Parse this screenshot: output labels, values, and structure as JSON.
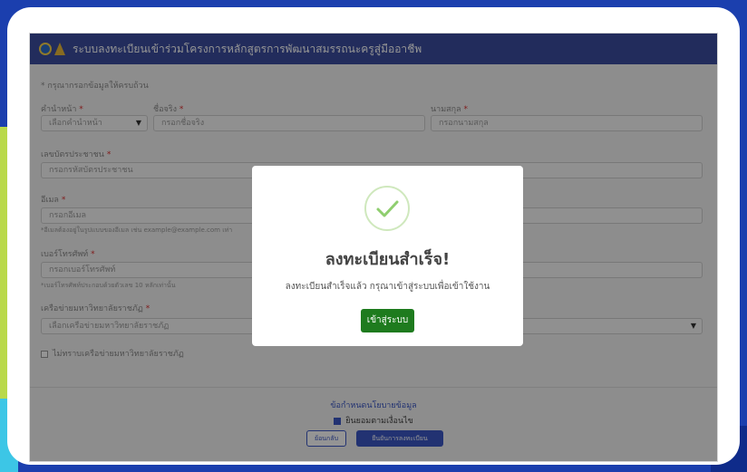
{
  "app": {
    "title": "ระบบลงทะเบียนเข้าร่วมโครงการหลักสูตรการพัฒนาสมรรถนะครูสู่มืออาชีพ"
  },
  "form": {
    "instruction": "* กรุณากรอกข้อมูลให้ครบถ้วน",
    "prefix": {
      "label": "คำนำหน้า",
      "value": "เลือกคำนำหน้า"
    },
    "firstname": {
      "label": "ชื่อจริง",
      "placeholder": "กรอกชื่อจริง"
    },
    "lastname": {
      "label": "นามสกุล",
      "placeholder": "กรอกนามสกุล"
    },
    "id_card": {
      "label": "เลขบัตรประชาชน",
      "placeholder": "กรอกรหัสบัตรประชาชน"
    },
    "email": {
      "label": "อีเมล",
      "placeholder": "กรอกอีเมล",
      "hint": "*อีเมลต้องอยู่ในรูปแบบของอีเมล เช่น example@example.com เท่า"
    },
    "phone": {
      "label": "เบอร์โทรศัพท์",
      "placeholder": "กรอกเบอร์โทรศัพท์",
      "hint": "*เบอร์โทรศัพท์ประกอบด้วยตัวเลข 10 หลักเท่านั้น"
    },
    "network": {
      "label": "เครือข่ายมหาวิทยาลัยราชภัฏ",
      "value": "เลือกเครือข่ายมหาวิทยาลัยราชภัฏ"
    },
    "unknown_network": {
      "label": "ไม่ทราบเครือข่ายมหาวิทยาลัยราชภัฏ",
      "checked": false
    },
    "required_mark": "*"
  },
  "footer": {
    "policy_link": "ข้อกำหนดนโยบายข้อมูล",
    "agree_label": "ยินยอมตามเงื่อนไข",
    "agree_checked": true,
    "back_button": "ย้อนกลับ",
    "confirm_button": "ยืนยันการลงทะเบียน"
  },
  "modal": {
    "icon": "check-circle-icon",
    "title": "ลงทะเบียนสำเร็จ!",
    "message": "ลงทะเบียนสำเร็จแล้ว กรุณาเข้าสู่ระบบเพื่อเข้าใช้งาน",
    "button": "เข้าสู่ระบบ"
  },
  "colors": {
    "header": "#3b4d9f",
    "primary": "#3b57c4",
    "success": "#1e7b1e",
    "background": "#1b3fae"
  }
}
